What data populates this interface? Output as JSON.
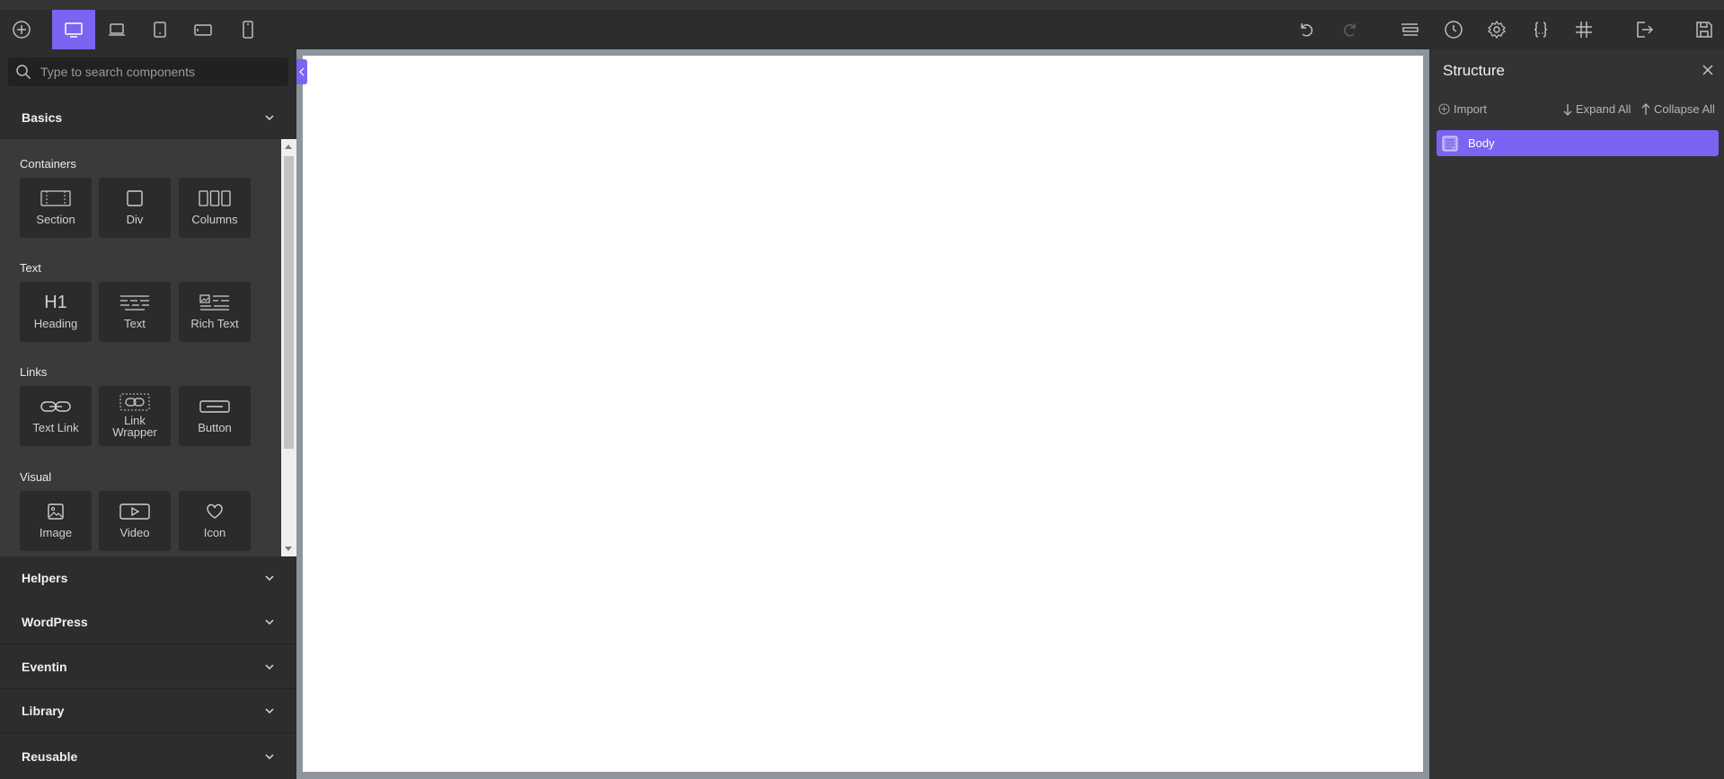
{
  "toolbar": {
    "left_icons": [
      "add-icon",
      "desktop-icon",
      "laptop-icon",
      "tablet-icon",
      "tablet-landscape-icon",
      "mobile-icon"
    ],
    "active_device": "desktop",
    "right_icons": [
      "undo-icon",
      "redo-icon",
      "layers-icon",
      "history-icon",
      "settings-icon",
      "code-icon",
      "grid-icon",
      "exit-icon",
      "save-icon"
    ]
  },
  "sidebar": {
    "search_placeholder": "Type to search components",
    "categories": [
      {
        "label": "Basics"
      },
      {
        "label": "Helpers"
      },
      {
        "label": "WordPress"
      },
      {
        "label": "Eventin"
      },
      {
        "label": "Library"
      },
      {
        "label": "Reusable"
      }
    ],
    "groups": [
      {
        "title": "Containers",
        "items": [
          "Section",
          "Div",
          "Columns"
        ]
      },
      {
        "title": "Text",
        "items": [
          "Heading",
          "Text",
          "Rich Text"
        ]
      },
      {
        "title": "Links",
        "items": [
          "Text Link",
          "Link Wrapper",
          "Button"
        ]
      },
      {
        "title": "Visual",
        "items": [
          "Image",
          "Video",
          "Icon"
        ]
      }
    ],
    "heading_glyph": "H1"
  },
  "structure": {
    "title": "Structure",
    "import_label": "Import",
    "expand_label": "Expand All",
    "collapse_label": "Collapse All",
    "nodes": [
      {
        "label": "Body"
      }
    ]
  },
  "colors": {
    "accent": "#7b64f2",
    "panel": "#2d2d2d",
    "canvas": "#ffffff"
  }
}
